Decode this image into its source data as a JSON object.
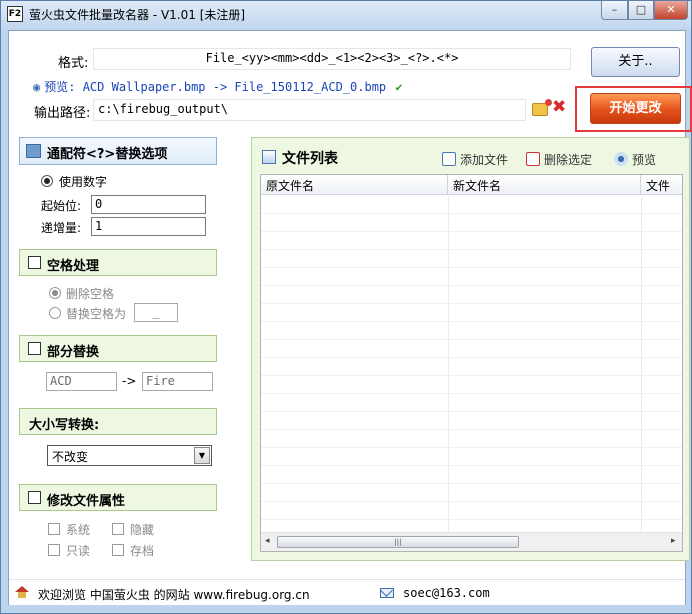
{
  "window": {
    "title": "萤火虫文件批量改名器 - V1.01 [未注册]",
    "app_icon_text": "F2",
    "min_label": "–",
    "max_label": "□",
    "close_label": "✕"
  },
  "form": {
    "format_label": "格式:",
    "format_value": "File_<yy><mm><dd>_<1><2><3>_<?>.<*>",
    "preview_label": "预览:",
    "preview_value": "ACD Wallpaper.bmp -> File_150112_ACD_0.bmp",
    "output_label": "输出路径:",
    "output_value": "c:\\firebug_output\\"
  },
  "buttons": {
    "about": "关于..",
    "start": "开始更改"
  },
  "wildcard": {
    "title": "通配符<?>替换选项",
    "use_number": "使用数字",
    "start_label": "起始位:",
    "start_value": "0",
    "step_label": "递增量:",
    "step_value": "1"
  },
  "space": {
    "title": "空格处理",
    "delete_space": "删除空格",
    "replace_space": "替换空格为",
    "replace_value": "_"
  },
  "partial": {
    "title": "部分替换",
    "from_value": "ACD",
    "arrow": "->",
    "to_value": "Fire"
  },
  "case": {
    "title": "大小写转换:",
    "selected": "不改变"
  },
  "attrs": {
    "title": "修改文件属性",
    "system": "系统",
    "hidden": "隐藏",
    "readonly": "只读",
    "archive": "存档"
  },
  "file_list": {
    "title": "文件列表",
    "add": "添加文件",
    "delete": "删除选定",
    "preview": "预览",
    "columns": [
      "原文件名",
      "新文件名",
      "文件"
    ],
    "scroll_left": "◂",
    "scroll_right": "▸",
    "thumb_grip": "|||"
  },
  "status": {
    "welcome": "欢迎浏览 中国萤火虫 的网站 www.firebug.org.cn",
    "email": "soec@163.com"
  },
  "colors": {
    "start_button": "#e5521c",
    "highlight_border": "#e53a3a",
    "section_green": "#eef7e2",
    "preview_text": "#1a45b8"
  }
}
